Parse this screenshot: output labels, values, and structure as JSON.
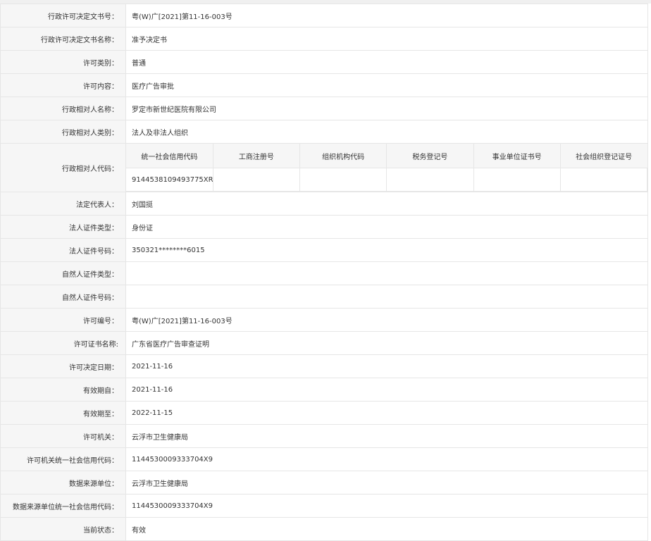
{
  "rows_top": [
    {
      "label": "行政许可决定文书号：",
      "value": "粤(W)广[2021]第11-16-003号"
    },
    {
      "label": "行政许可决定文书名称：",
      "value": "准予决定书"
    },
    {
      "label": "许可类别：",
      "value": "普通"
    },
    {
      "label": "许可内容：",
      "value": "医疗广告审批"
    },
    {
      "label": "行政相对人名称：",
      "value": "罗定市新世纪医院有限公司"
    },
    {
      "label": "行政相对人类别：",
      "value": "法人及非法人组织"
    }
  ],
  "party_codes": {
    "label": "行政相对人代码：",
    "headers": [
      "统一社会信用代码",
      "工商注册号",
      "组织机构代码",
      "税务登记号",
      "事业单位证书号",
      "社会组织登记证号"
    ],
    "values": [
      "9144538109493775XR",
      "",
      "",
      "",
      "",
      ""
    ]
  },
  "rows_bottom": [
    {
      "label": "法定代表人：",
      "value": "刘国挺"
    },
    {
      "label": "法人证件类型：",
      "value": "身份证"
    },
    {
      "label": "法人证件号码：",
      "value": "350321********6015"
    },
    {
      "label": "自然人证件类型：",
      "value": ""
    },
    {
      "label": "自然人证件号码：",
      "value": ""
    },
    {
      "label": "许可编号：",
      "value": "粤(W)广[2021]第11-16-003号"
    },
    {
      "label": "许可证书名称:",
      "value": "广东省医疗广告审查证明"
    },
    {
      "label": "许可决定日期：",
      "value": "2021-11-16"
    },
    {
      "label": "有效期自：",
      "value": "2021-11-16"
    },
    {
      "label": "有效期至：",
      "value": "2022-11-15"
    },
    {
      "label": "许可机关：",
      "value": "云浮市卫生健康局"
    },
    {
      "label": "许可机关统一社会信用代码：",
      "value": "1144530009333704X9"
    },
    {
      "label": "数据来源单位：",
      "value": "云浮市卫生健康局"
    },
    {
      "label": "数据来源单位统一社会信用代码：",
      "value": "1144530009333704X9"
    },
    {
      "label": "当前状态：",
      "value": "有效"
    }
  ]
}
